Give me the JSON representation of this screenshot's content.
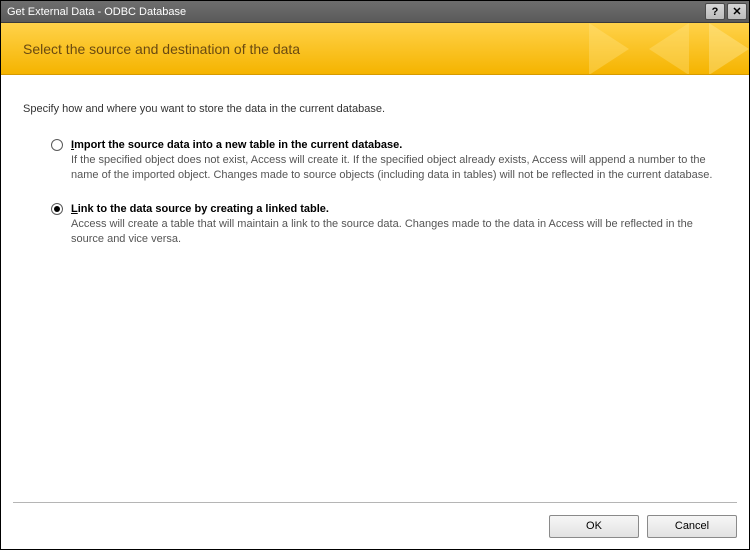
{
  "window": {
    "title": "Get External Data - ODBC Database"
  },
  "header": {
    "title": "Select the source and destination of the data"
  },
  "prompt": "Specify how and where you want to store the data in the current database.",
  "options": [
    {
      "accel": "I",
      "label_rest": "mport the source data into a new table in the current database.",
      "description": "If the specified object does not exist, Access will create it. If the specified object already exists, Access will append a number to the name of the imported object. Changes made to source objects (including data in tables) will not be reflected in the current database.",
      "checked": false
    },
    {
      "accel": "L",
      "label_rest": "ink to the data source by creating a linked table.",
      "description": "Access will create a table that will maintain a link to the source data. Changes made to the data in Access will be reflected in the source and vice versa.",
      "checked": true
    }
  ],
  "buttons": {
    "ok": "OK",
    "cancel": "Cancel"
  },
  "titlebar_icons": {
    "help": "?",
    "close": "✕"
  }
}
